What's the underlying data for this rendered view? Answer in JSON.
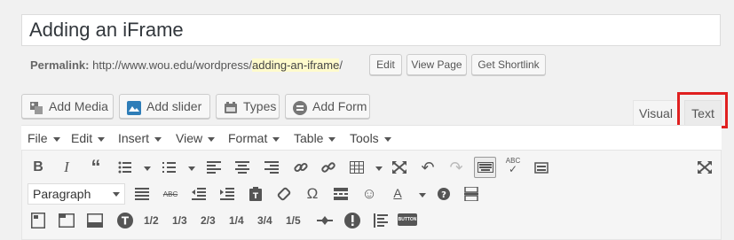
{
  "post": {
    "title": "Adding an iFrame"
  },
  "permalink": {
    "label": "Permalink:",
    "base_url": "http://www.wou.edu/wordpress/",
    "slug": "adding-an-iframe",
    "trail": "/",
    "edit_label": "Edit",
    "view_label": "View Page",
    "shortlink_label": "Get Shortlink"
  },
  "media_buttons": [
    {
      "label": "Add Media",
      "icon": "add-media-icon"
    },
    {
      "label": "Add slider",
      "icon": "slider-icon"
    },
    {
      "label": "Types",
      "icon": "types-icon"
    },
    {
      "label": "Add Form",
      "icon": "form-icon"
    }
  ],
  "editor_tabs": {
    "visual": "Visual",
    "text": "Text",
    "highlighted": "text",
    "highlight_color": "#e02020"
  },
  "menubar": [
    "File",
    "Edit",
    "Insert",
    "View",
    "Format",
    "Table",
    "Tools"
  ],
  "toolbar": {
    "format_select": "Paragraph",
    "fractions": [
      "1/2",
      "1/3",
      "2/3",
      "1/4",
      "3/4",
      "1/5"
    ],
    "row1_icons": [
      "bold-icon",
      "italic-icon",
      "blockquote-icon",
      "bullet-list-icon",
      "numbered-list-icon",
      "align-left-icon",
      "align-center-icon",
      "align-right-icon",
      "link-icon",
      "unlink-icon",
      "table-icon",
      "fullscreen-icon",
      "undo-icon",
      "redo-icon",
      "keyboard-icon",
      "spellcheck-icon",
      "paste-icon",
      "distraction-free-icon"
    ],
    "row2_icons": [
      "horizontal-line-icon",
      "strikethrough-icon",
      "outdent-icon",
      "indent-icon",
      "paste-text-icon",
      "clear-formatting-icon",
      "special-character-icon",
      "read-more-icon",
      "emoji-icon",
      "text-color-icon",
      "help-icon",
      "page-break-icon"
    ],
    "row3_icons": [
      "columns-icon",
      "tabs-icon",
      "toggle-icon",
      "tooltip-icon",
      "divider-icon",
      "alert-icon",
      "list-style-icon",
      "button-icon"
    ],
    "row3_button_text": "BUTTON"
  }
}
